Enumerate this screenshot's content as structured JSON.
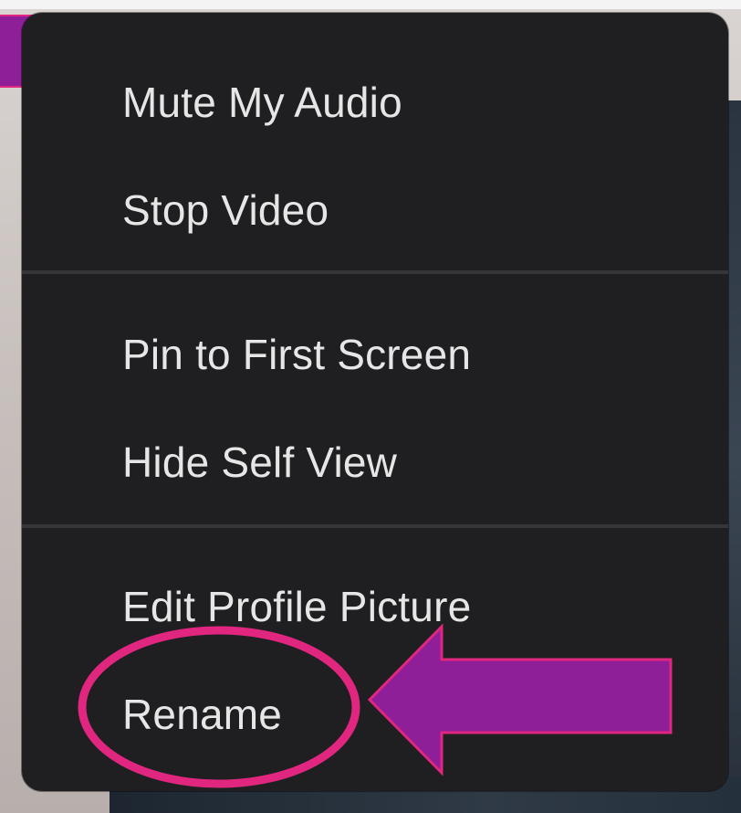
{
  "menu": {
    "items": [
      {
        "label": "Mute My Audio",
        "group": 1
      },
      {
        "label": "Stop Video",
        "group": 1
      },
      {
        "label": "Pin to First Screen",
        "group": 2
      },
      {
        "label": "Hide Self View",
        "group": 2
      },
      {
        "label": "Edit Profile Picture",
        "group": 3
      },
      {
        "label": "Rename",
        "group": 3,
        "highlighted": true
      }
    ]
  },
  "annotations": {
    "highlight_color": "#e0267f",
    "arrow_fill": "#8f1f98",
    "corner_box_fill": "#8f1f98"
  },
  "colors": {
    "menu_background": "#1f1f21",
    "menu_text": "#e6e6e6",
    "separator": "#36363a"
  }
}
